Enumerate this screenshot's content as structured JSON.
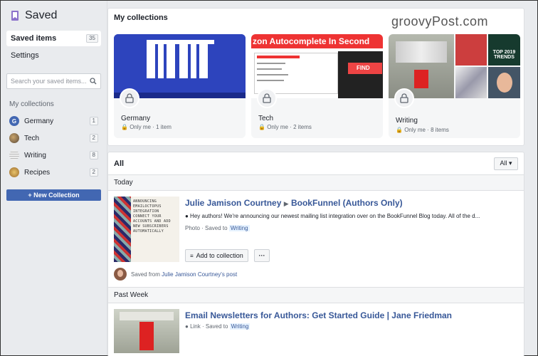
{
  "brand": {
    "watermark": "groovyPost.com"
  },
  "sidebar": {
    "title": "Saved",
    "items": [
      {
        "label": "Saved items",
        "count": "35"
      },
      {
        "label": "Settings"
      }
    ],
    "search_placeholder": "Search your saved items...",
    "collections_heading": "My collections",
    "collections": [
      {
        "label": "Germany",
        "count": "1",
        "icon": "G"
      },
      {
        "label": "Tech",
        "count": "2"
      },
      {
        "label": "Writing",
        "count": "8"
      },
      {
        "label": "Recipes",
        "count": "2"
      }
    ],
    "new_collection": "+ New Collection"
  },
  "collections_panel": {
    "heading": "My collections",
    "cards": [
      {
        "name": "Germany",
        "meta": "Only me · 1 item"
      },
      {
        "name": "Tech",
        "meta": "Only me · 2 items",
        "banner": "zon Autocomplete In Second",
        "find": "FIND"
      },
      {
        "name": "Writing",
        "meta": "Only me · 8 items",
        "trends": "TOP 2019 TRENDS"
      }
    ]
  },
  "feed": {
    "heading": "All",
    "filter": "All ▾",
    "sections": [
      {
        "label": "Today",
        "post": {
          "author": "Julie Jamison Courtney",
          "target": "BookFunnel (Authors Only)",
          "desc": "● Hey authors! We're announcing our newest mailing list integration over on the BookFunnel Blog today. All of the d...",
          "type": "Photo",
          "saved_to": "Saved to",
          "collection": "Writing",
          "add_label": "Add to collection",
          "more": "···",
          "saved_from": "Saved from",
          "saved_from_name": "Julie Jamison Courtney's post",
          "thumb_text": "ANNOUNCING EMAILOCTOPUS INTEGRATION CONNECT YOUR ACCOUNTS AND ADD NEW SUBSCRIBERS AUTOMATICALLY"
        }
      },
      {
        "label": "Past Week",
        "post": {
          "title": "Email Newsletters for Authors: Get Started Guide | Jane Friedman",
          "type": "Link",
          "saved_to": "Saved to",
          "collection": "Writing"
        }
      }
    ]
  },
  "colors": {
    "accent": "#4267b2",
    "link": "#385898",
    "germany_blue": "#1f3ea6"
  }
}
